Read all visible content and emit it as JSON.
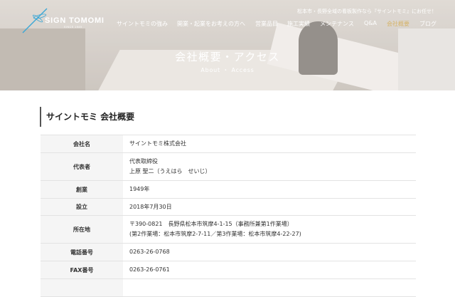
{
  "header": {
    "logo_text": "SIGN TOMOMI",
    "logo_sub": "SINCE 1949",
    "tagline": "松本市・長野全域の看板製作なら『サイントモミ』にお任せ！",
    "nav": [
      {
        "label": "サイントモミの強み"
      },
      {
        "label": "開業・起業をお考えの方へ"
      },
      {
        "label": "営業品目"
      },
      {
        "label": "施工実績"
      },
      {
        "label": "メンテナンス"
      },
      {
        "label": "Q&A"
      },
      {
        "label": "会社概要"
      },
      {
        "label": "ブログ"
      }
    ]
  },
  "hero": {
    "title": "会社概要・アクセス",
    "subtitle": "About ・ Access"
  },
  "section": {
    "heading": "サイントモミ 会社概要"
  },
  "company_table": {
    "rows": [
      {
        "label": "会社名",
        "lines": [
          "サイントモミ株式会社"
        ]
      },
      {
        "label": "代表者",
        "lines": [
          "代表取締役",
          "上原 聖二（うえはら　せいじ）"
        ]
      },
      {
        "label": "創業",
        "lines": [
          "1949年"
        ]
      },
      {
        "label": "設立",
        "lines": [
          "2018年7月30日"
        ]
      },
      {
        "label": "所在地",
        "lines": [
          "〒390-0821　長野県松本市筑摩4-1-15（事務所兼第1作業場）",
          "(第2作業場：松本市筑摩2-7-11／第3作業場：松本市筑摩4-22-27)"
        ]
      },
      {
        "label": "電話番号",
        "lines": [
          "0263-26-0768"
        ]
      },
      {
        "label": "FAX番号",
        "lines": [
          "0263-26-0761"
        ]
      }
    ]
  },
  "colors": {
    "nav_active": "#d6b46a",
    "logo_accent": "#3aa7d6"
  }
}
